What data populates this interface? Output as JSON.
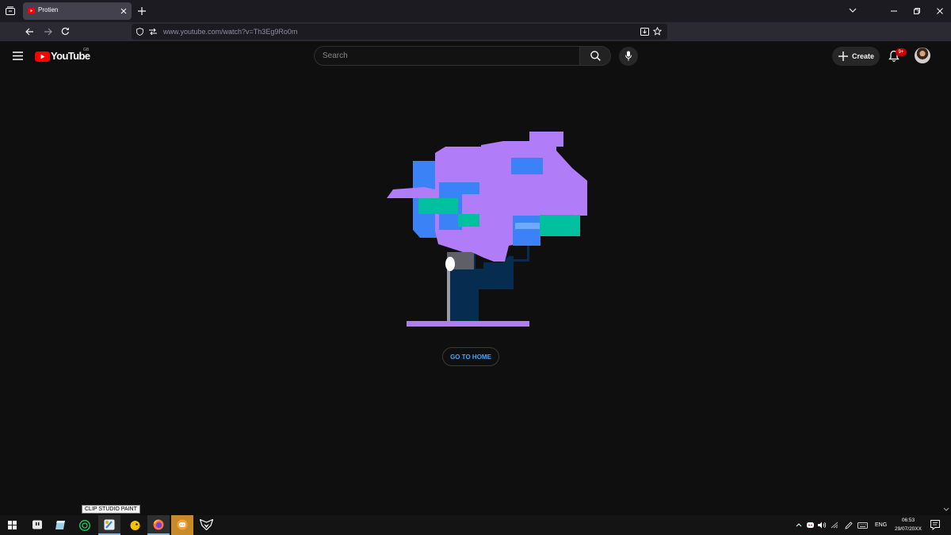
{
  "browser": {
    "tab": {
      "title": "Protien"
    },
    "address_bar": {
      "url": "www.youtube.com/watch?v=Th3Eg9Ro0m"
    }
  },
  "youtube": {
    "logo_text": "YouTube",
    "country_code": "GB",
    "search": {
      "placeholder": "Search"
    },
    "create_label": "Create",
    "notification_count": "9+"
  },
  "main": {
    "home_button_label": "GO TO HOME"
  },
  "taskbar": {
    "tooltip": "CLIP STUDIO PAINT",
    "tray": {
      "language": "ENG",
      "time": "06:53",
      "date": "29/07/20XX"
    }
  },
  "colors": {
    "page_bg": "#0f0f0f",
    "tree_purple": "#b07cf7",
    "tree_blue": "#3b82f6",
    "tree_teal": "#00c0a0",
    "trunk_navy": "#062d4f",
    "link_blue": "#3ea6ff",
    "youtube_red": "#ff0000"
  },
  "icons": [
    "tab-overview-icon",
    "youtube-favicon",
    "close-icon",
    "new-tab-icon",
    "chevron-down-icon",
    "minimize-icon",
    "restore-icon",
    "window-close-icon",
    "back-arrow-icon",
    "forward-arrow-icon",
    "reload-icon",
    "shield-icon",
    "permissions-icon",
    "install-app-icon",
    "bookmark-star-icon",
    "hamburger-menu-icon",
    "youtube-logo-icon",
    "search-icon",
    "microphone-icon",
    "plus-icon",
    "bell-icon",
    "windows-start-icon"
  ]
}
